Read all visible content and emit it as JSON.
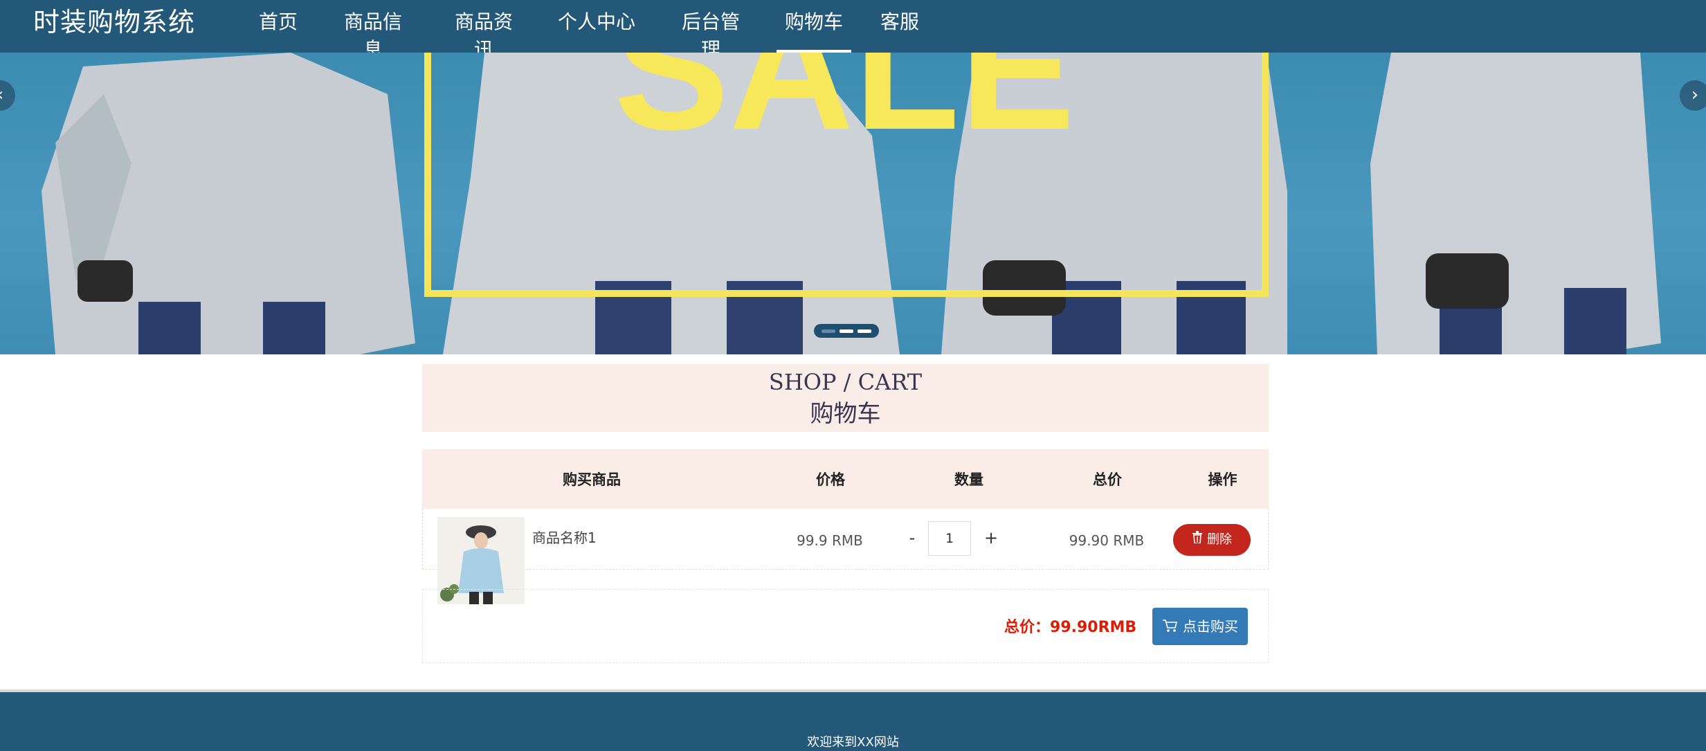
{
  "brand": "时装购物系统",
  "nav": {
    "items": [
      {
        "label": "首页"
      },
      {
        "label": "商品信息"
      },
      {
        "label": "商品资讯"
      },
      {
        "label": "个人中心"
      },
      {
        "label": "后台管理"
      },
      {
        "label": "购物车"
      },
      {
        "label": "客服"
      }
    ],
    "active": "购物车"
  },
  "banner": {
    "text": "SALE",
    "prev_icon": "chevron-left-icon",
    "next_icon": "chevron-right-icon",
    "slide_count": 3,
    "active_slide": 1
  },
  "section": {
    "title_en": "SHOP / CART",
    "title_cn": "购物车"
  },
  "cart": {
    "headers": [
      "购买商品",
      "价格",
      "数量",
      "总价",
      "操作"
    ],
    "items": [
      {
        "name": "商品名称1",
        "price": "99.9 RMB",
        "quantity": "1",
        "total": "99.90 RMB",
        "minus": "-",
        "plus": "+",
        "delete_label": "删除",
        "delete_icon": "trash-icon"
      }
    ],
    "summary_label": "总价：",
    "summary_value": "99.90RMB",
    "buy_label": "点击购买",
    "buy_icon": "cart-icon"
  },
  "footer": {
    "text": "欢迎来到XX网站"
  },
  "colors": {
    "nav_bg": "#245878",
    "section_bg": "#faede8",
    "delete_btn": "#c2261c",
    "buy_btn": "#337ab7",
    "total_text": "#d81e06"
  }
}
